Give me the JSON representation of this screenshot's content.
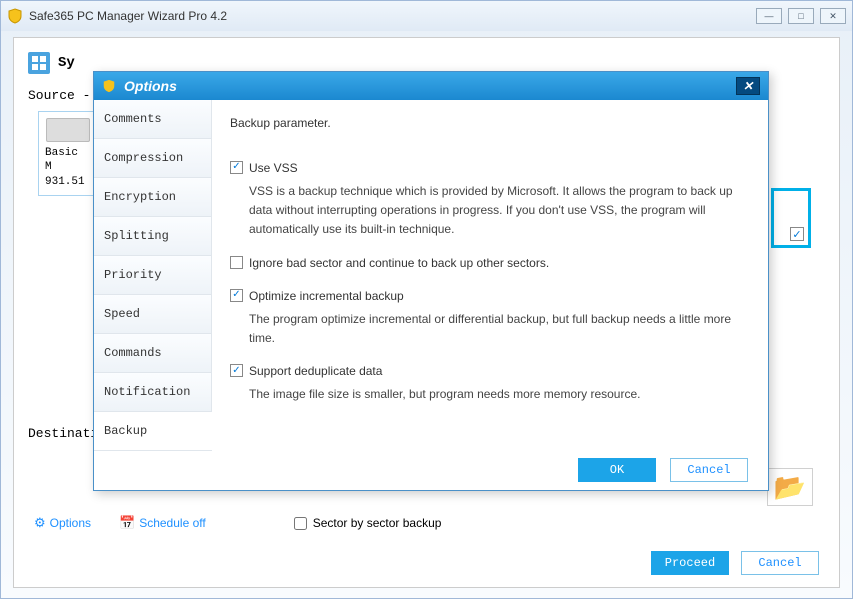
{
  "outerWindow": {
    "title": "Safe365 PC Manager Wizard Pro 4.2"
  },
  "main": {
    "topTab": "Sy",
    "sourceLabel": "Source -",
    "destinationLabel": "Destinati",
    "disk": {
      "name": "Basic M",
      "size": "931.51"
    },
    "optionsLink": "Options",
    "scheduleLink": "Schedule off",
    "sectorCheck": "Sector by sector backup",
    "proceed": "Proceed",
    "cancel": "Cancel"
  },
  "dialog": {
    "title": "Options",
    "sidebar": [
      "Comments",
      "Compression",
      "Encryption",
      "Splitting",
      "Priority",
      "Speed",
      "Commands",
      "Notification",
      "Backup"
    ],
    "activeIndex": 8,
    "heading": "Backup parameter.",
    "useVss": {
      "label": "Use VSS",
      "checked": true,
      "desc": "VSS is a backup technique which is provided by Microsoft. It allows the program to back up data without interrupting operations in progress. If you don't use VSS, the program will automatically use its built-in technique."
    },
    "ignoreBad": {
      "label": "Ignore bad sector and continue to back up other sectors.",
      "checked": false
    },
    "optimize": {
      "label": "Optimize incremental backup",
      "checked": true,
      "desc": "The program optimize incremental or differential backup, but full backup needs a little more time."
    },
    "dedup": {
      "label": "Support deduplicate data",
      "checked": true,
      "desc": "The image file size is smaller, but program needs more memory resource."
    },
    "ok": "OK",
    "cancel": "Cancel"
  }
}
